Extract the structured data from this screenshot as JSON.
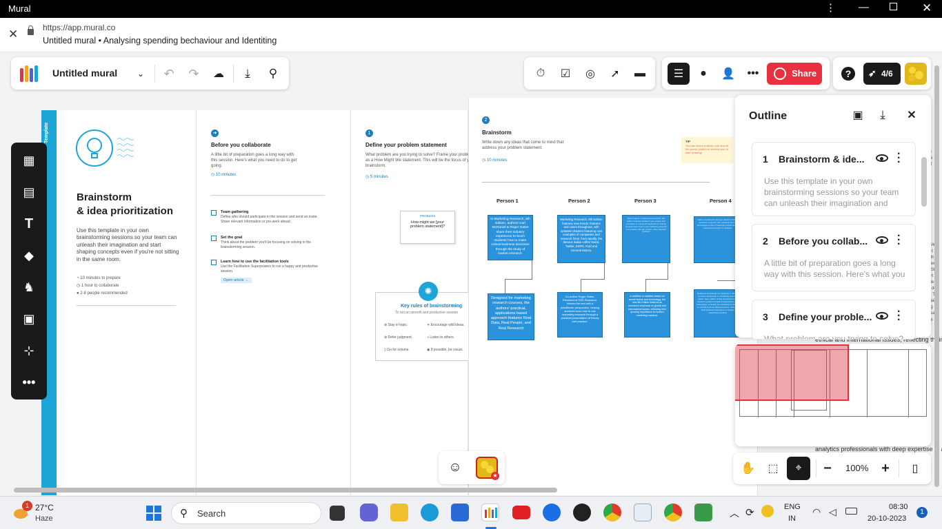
{
  "window": {
    "title": "Mural"
  },
  "address": {
    "url": "https://app.mural.co",
    "tab_title": "Untitled mural • Analysing spending bechaviour and Identiting"
  },
  "toolbar": {
    "mural_name": "Untitled mural",
    "share_label": "Share",
    "progress": "4/6"
  },
  "template": {
    "sidebar_label": "Template",
    "title_line1": "Brainstorm",
    "title_line2": "& idea prioritization",
    "description": "Use this template in your own brainstorming sessions so your team can unleash their imagination and start shaping concepts even if you're not sitting in the same room.",
    "meta": [
      "10 minutes to prepare",
      "1 hour to collaborate",
      "2-8 people recommended"
    ]
  },
  "section_before": {
    "heading": "Before you collaborate",
    "intro": "A little bit of preparation goes a long way with this session. Here's what you need to do to get going.",
    "time": "10 minutes",
    "steps": [
      {
        "title": "Team gathering",
        "text": "Define who should participate in the session and send an invite. Share relevant information or pre-work ahead."
      },
      {
        "title": "Set the goal",
        "text": "Think about the problem you'll be focusing on solving in the brainstorming session."
      },
      {
        "title": "Learn how to use the facilitation tools",
        "text": "Use the Facilitation Superpowers to run a happy and productive session."
      }
    ],
    "link": "Open article"
  },
  "section_define": {
    "number": "1",
    "heading": "Define your problem statement",
    "intro": "What problem are you trying to solve? Frame your problem as a How Might We statement. This will be the focus of your brainstorm.",
    "time": "5 minutes",
    "card_label": "PROBLEM",
    "card_text": "How might we [your problem statement]?",
    "rules_title": "Key rules of brainstorming",
    "rules_sub": "To run an smooth and productive session",
    "rules": [
      "Stay in topic.",
      "Encourage wild ideas.",
      "Defer judgment.",
      "Listen to others.",
      "Go for volume.",
      "If possible, be visual."
    ]
  },
  "section_brainstorm": {
    "number": "2",
    "heading": "Brainstorm",
    "intro": "Write down any ideas that come to mind that address your problem statement.",
    "time": "10 minutes",
    "tip_label": "TIP",
    "tip_text": "You can select a sticky note and hit the pencil (switch to sketch) icon to start drawing!",
    "people": [
      "Person 1",
      "Person 2",
      "Person 3",
      "Person 4"
    ],
    "notes_top": [
      "In Marketing Research, 9th Edition, authors Carl McDaniel & Roger Gates share their industry experience to teach students how to make critical business decisions through the study of market research.",
      "Marketing Research, 9th Edition features new trends, features and cases throughout, with updated chapters featuring new examples of companies and research firms, from Spotify, the famous Italian coffee brand, Twitter, ESPN, Ford and General Motors.",
      "Each chapter in Marketing Research, 9th Edition features updated case studies and examples of real-world applications, helping students learn how to put marketing research into practice through modern data collection methods.",
      "Gates co-authored this text, which combines academic research with practical industry knowledge to offer a balanced introduction to marketing research for students."
    ],
    "notes_bottom": [
      "Designed for marketing research courses, the authors' practical, applications based approach features Real Data, Real People, and Real Research",
      "Co-author Roger Gates, President of DSS Research, infuses the text with a practitioner perspective, helping students learn how to use marketing research through a practical presentation of theory and practice.",
      "In addition to updates based on recent trends and technology, the new 9th Edition features an increased emphasis on global and international issues, reflecting their growing importance in modern marketing research.",
      "Designed specifically for students, it offers a concise introduction to marketing research topics. New edition of this successful book features updated research approaches and technology, including an increased emphasis on ethical and international issues, reflecting their growing importance in modern marketing research."
    ]
  },
  "outline": {
    "title": "Outline",
    "items": [
      {
        "num": "1",
        "title": "Brainstorm  & ide...",
        "desc": "Use this template in your own brainstorming sessions so your team can unleash their imagination and"
      },
      {
        "num": "2",
        "title": "Before you collab...",
        "desc": "A little bit of preparation goes a long way with this session. Here's what you"
      },
      {
        "num": "3",
        "title": "Define your proble...",
        "desc": "What problem are you trying to solve?"
      }
    ]
  },
  "right_text": {
    "line1": "ethical and international issues, reflecting their grow",
    "line2": "analytics professionals with deep expertise in all asp"
  },
  "zoom": {
    "level": "100%"
  },
  "taskbar": {
    "weather_temp": "27°C",
    "weather_desc": "Haze",
    "weather_badge": "1",
    "search": "Search",
    "lang1": "ENG",
    "lang2": "IN",
    "time": "08:30",
    "date": "20-10-2023",
    "notif": "1"
  },
  "colors": {
    "accent_red": "#e8303e",
    "template_blue": "#1ea5d8",
    "sticky_blue": "#2b93dc"
  }
}
